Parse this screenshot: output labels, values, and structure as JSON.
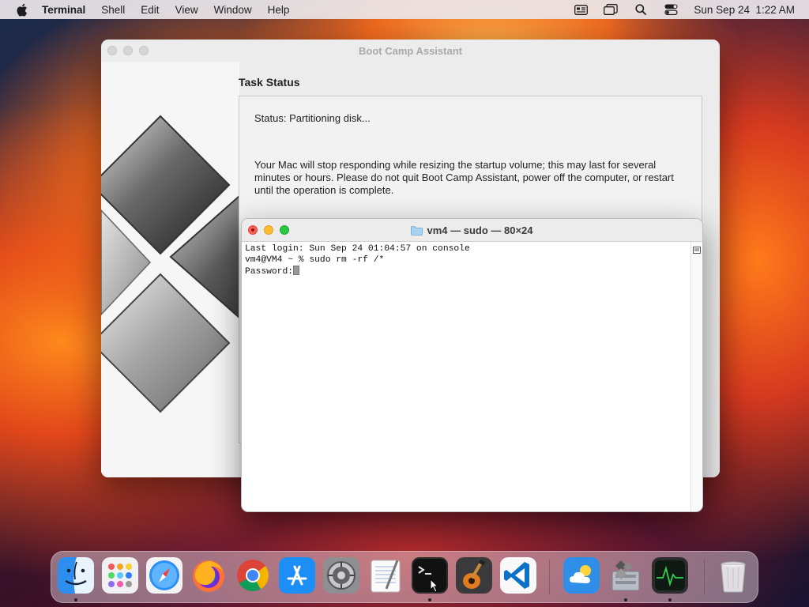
{
  "menubar": {
    "app_name": "Terminal",
    "menus": [
      "Shell",
      "Edit",
      "View",
      "Window",
      "Help"
    ],
    "clock": "Sun Sep 24  1:22 AM",
    "status_icons": [
      "keyboard-input-icon",
      "window-mirror-icon",
      "spotlight-search-icon",
      "control-center-icon"
    ]
  },
  "bootcamp": {
    "title": "Boot Camp Assistant",
    "heading": "Task Status",
    "status": "Status: Partitioning disk...",
    "message": "Your Mac will stop responding while resizing the startup volume; this may last for several minutes or hours. Please do not quit Boot Camp Assistant, power off the computer, or restart until the operation is complete."
  },
  "terminal": {
    "title": "vm4 — sudo — 80×24",
    "lines": [
      "Last login: Sun Sep 24 01:04:57 on console",
      "vm4@VM4 ~ % sudo rm -rf /*",
      "Password:"
    ]
  },
  "dock": {
    "apps": [
      "finder",
      "launchpad",
      "safari",
      "firefox",
      "chrome",
      "app-store",
      "system-preferences",
      "textedit",
      "terminal",
      "garageband",
      "vscode"
    ],
    "extras": [
      "weather",
      "boot-camp-assistant",
      "activity-monitor"
    ],
    "trash": "trash",
    "running": [
      "finder",
      "terminal",
      "boot-camp-assistant",
      "activity-monitor"
    ]
  },
  "colors": {
    "accent_red": "#ff5f57",
    "accent_yellow": "#febc2e",
    "accent_green": "#28c840"
  }
}
